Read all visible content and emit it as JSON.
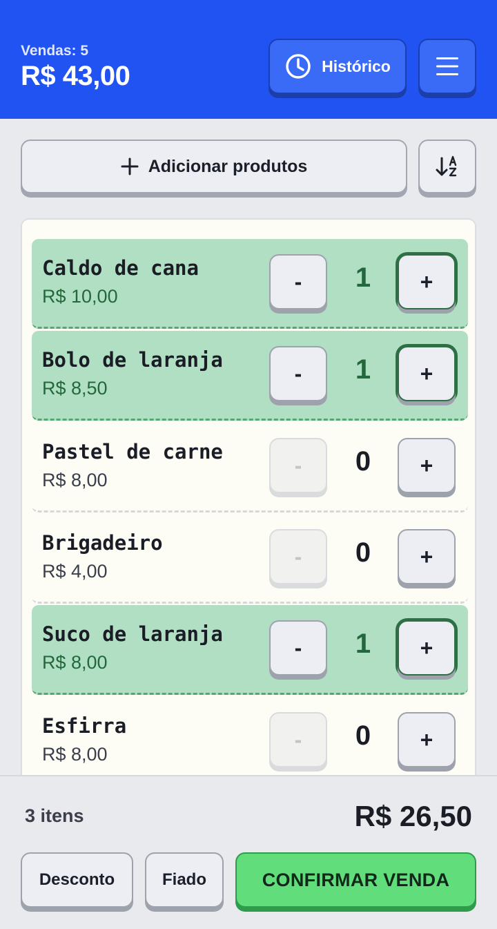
{
  "header": {
    "sales_label": "Vendas: 5",
    "sales_total": "R$ 43,00",
    "history_label": "Histórico",
    "history_icon": "clock-icon",
    "menu_icon": "hamburger-menu-icon"
  },
  "toolbar": {
    "add_label": "Adicionar produtos",
    "add_icon": "plus-icon",
    "sort_icon": "sort-alpha-icon"
  },
  "products": [
    {
      "name": "Caldo de cana",
      "price": "R$ 10,00",
      "qty": "1",
      "minus": "-",
      "plus": "+"
    },
    {
      "name": "Bolo de laranja",
      "price": "R$ 8,50",
      "qty": "1",
      "minus": "-",
      "plus": "+"
    },
    {
      "name": "Pastel de carne",
      "price": "R$ 8,00",
      "qty": "0",
      "minus": "-",
      "plus": "+"
    },
    {
      "name": "Brigadeiro",
      "price": "R$ 4,00",
      "qty": "0",
      "minus": "-",
      "plus": "+"
    },
    {
      "name": "Suco de laranja",
      "price": "R$ 8,00",
      "qty": "1",
      "minus": "-",
      "plus": "+"
    },
    {
      "name": "Esfirra",
      "price": "R$ 8,00",
      "qty": "0",
      "minus": "-",
      "plus": "+"
    }
  ],
  "footer": {
    "item_count": "3 itens",
    "total": "R$ 26,50",
    "discount_label": "Desconto",
    "fiado_label": "Fiado",
    "confirm_label": "CONFIRMAR VENDA"
  },
  "colors": {
    "header_bg": "#2152f2",
    "active_row": "#b1dfc3",
    "confirm": "#62dd7b"
  }
}
